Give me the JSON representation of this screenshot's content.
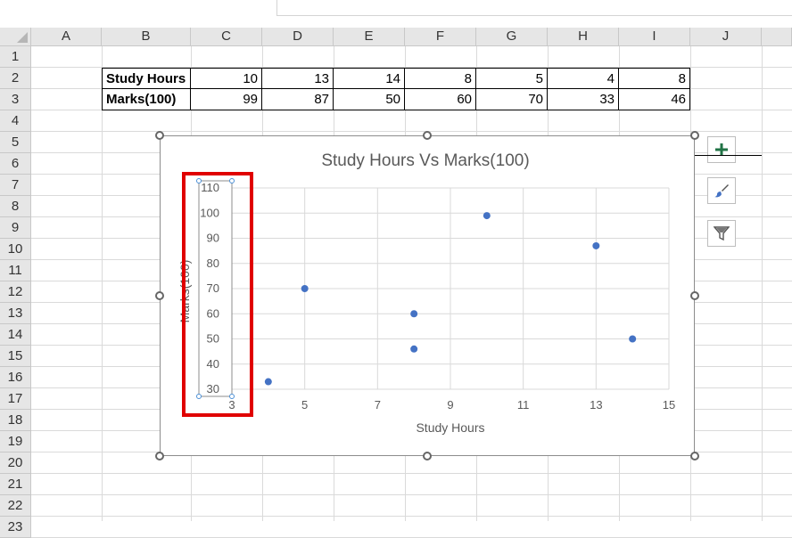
{
  "columns": [
    "A",
    "B",
    "C",
    "D",
    "E",
    "F",
    "G",
    "H",
    "I",
    "J"
  ],
  "rows": [
    "1",
    "2",
    "3",
    "4",
    "5",
    "6",
    "7",
    "8",
    "9",
    "10",
    "11",
    "12",
    "13",
    "14",
    "15",
    "16",
    "17",
    "18",
    "19",
    "20",
    "21",
    "22",
    "23"
  ],
  "table": {
    "row_labels": [
      "Study Hours",
      "Marks(100)"
    ],
    "study_hours": [
      "10",
      "13",
      "14",
      "8",
      "5",
      "4",
      "8"
    ],
    "marks": [
      "99",
      "87",
      "50",
      "60",
      "70",
      "33",
      "46"
    ]
  },
  "chart_data": {
    "type": "scatter",
    "title": "Study Hours Vs Marks(100)",
    "xlabel": "Study Hours",
    "ylabel": "Marks(100)",
    "xlim": [
      3,
      15
    ],
    "ylim": [
      30,
      110
    ],
    "x_ticks": [
      "3",
      "5",
      "7",
      "9",
      "11",
      "13",
      "15"
    ],
    "y_ticks": [
      "110",
      "100",
      "90",
      "80",
      "70",
      "60",
      "50",
      "40",
      "30"
    ],
    "grid": true,
    "points": [
      {
        "x": 10,
        "y": 99
      },
      {
        "x": 13,
        "y": 87
      },
      {
        "x": 14,
        "y": 50
      },
      {
        "x": 8,
        "y": 60
      },
      {
        "x": 5,
        "y": 70
      },
      {
        "x": 4,
        "y": 33
      },
      {
        "x": 8,
        "y": 46
      }
    ],
    "marker_color": "#4472c4"
  },
  "side_buttons": [
    "plus-icon",
    "brush-icon",
    "filter-icon"
  ],
  "colors": {
    "highlight": "#e00000",
    "accent": "#4472c4",
    "plus": "#217346"
  }
}
